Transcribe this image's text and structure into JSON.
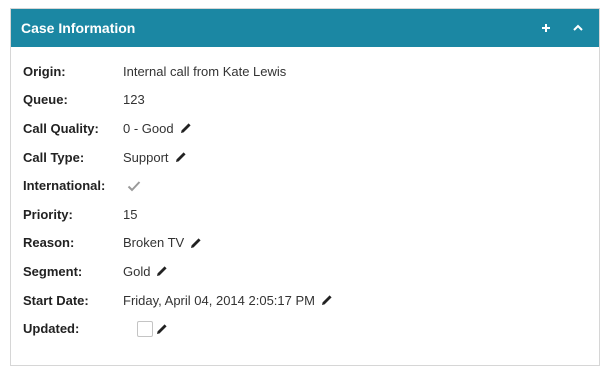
{
  "panel": {
    "title": "Case Information",
    "add_icon": "plus-icon",
    "collapse_icon": "chevron-up-icon",
    "header_color": "#1b87a3"
  },
  "fields": {
    "origin": {
      "label": "Origin:",
      "value": "Internal call from Kate Lewis"
    },
    "queue": {
      "label": "Queue:",
      "value": "123"
    },
    "call_quality": {
      "label": "Call Quality:",
      "value": "0 - Good"
    },
    "call_type": {
      "label": "Call Type:",
      "value": "Support"
    },
    "international": {
      "label": "International:",
      "checked": true
    },
    "priority": {
      "label": "Priority:",
      "value": "15"
    },
    "reason": {
      "label": "Reason:",
      "value": "Broken TV"
    },
    "segment": {
      "label": "Segment:",
      "value": "Gold"
    },
    "start_date": {
      "label": "Start Date:",
      "value": "Friday, April 04, 2014 2:05:17 PM"
    },
    "updated": {
      "label": "Updated:",
      "checked": false
    }
  },
  "icons": {
    "edit": "pencil-icon",
    "check": "checkmark-icon"
  }
}
